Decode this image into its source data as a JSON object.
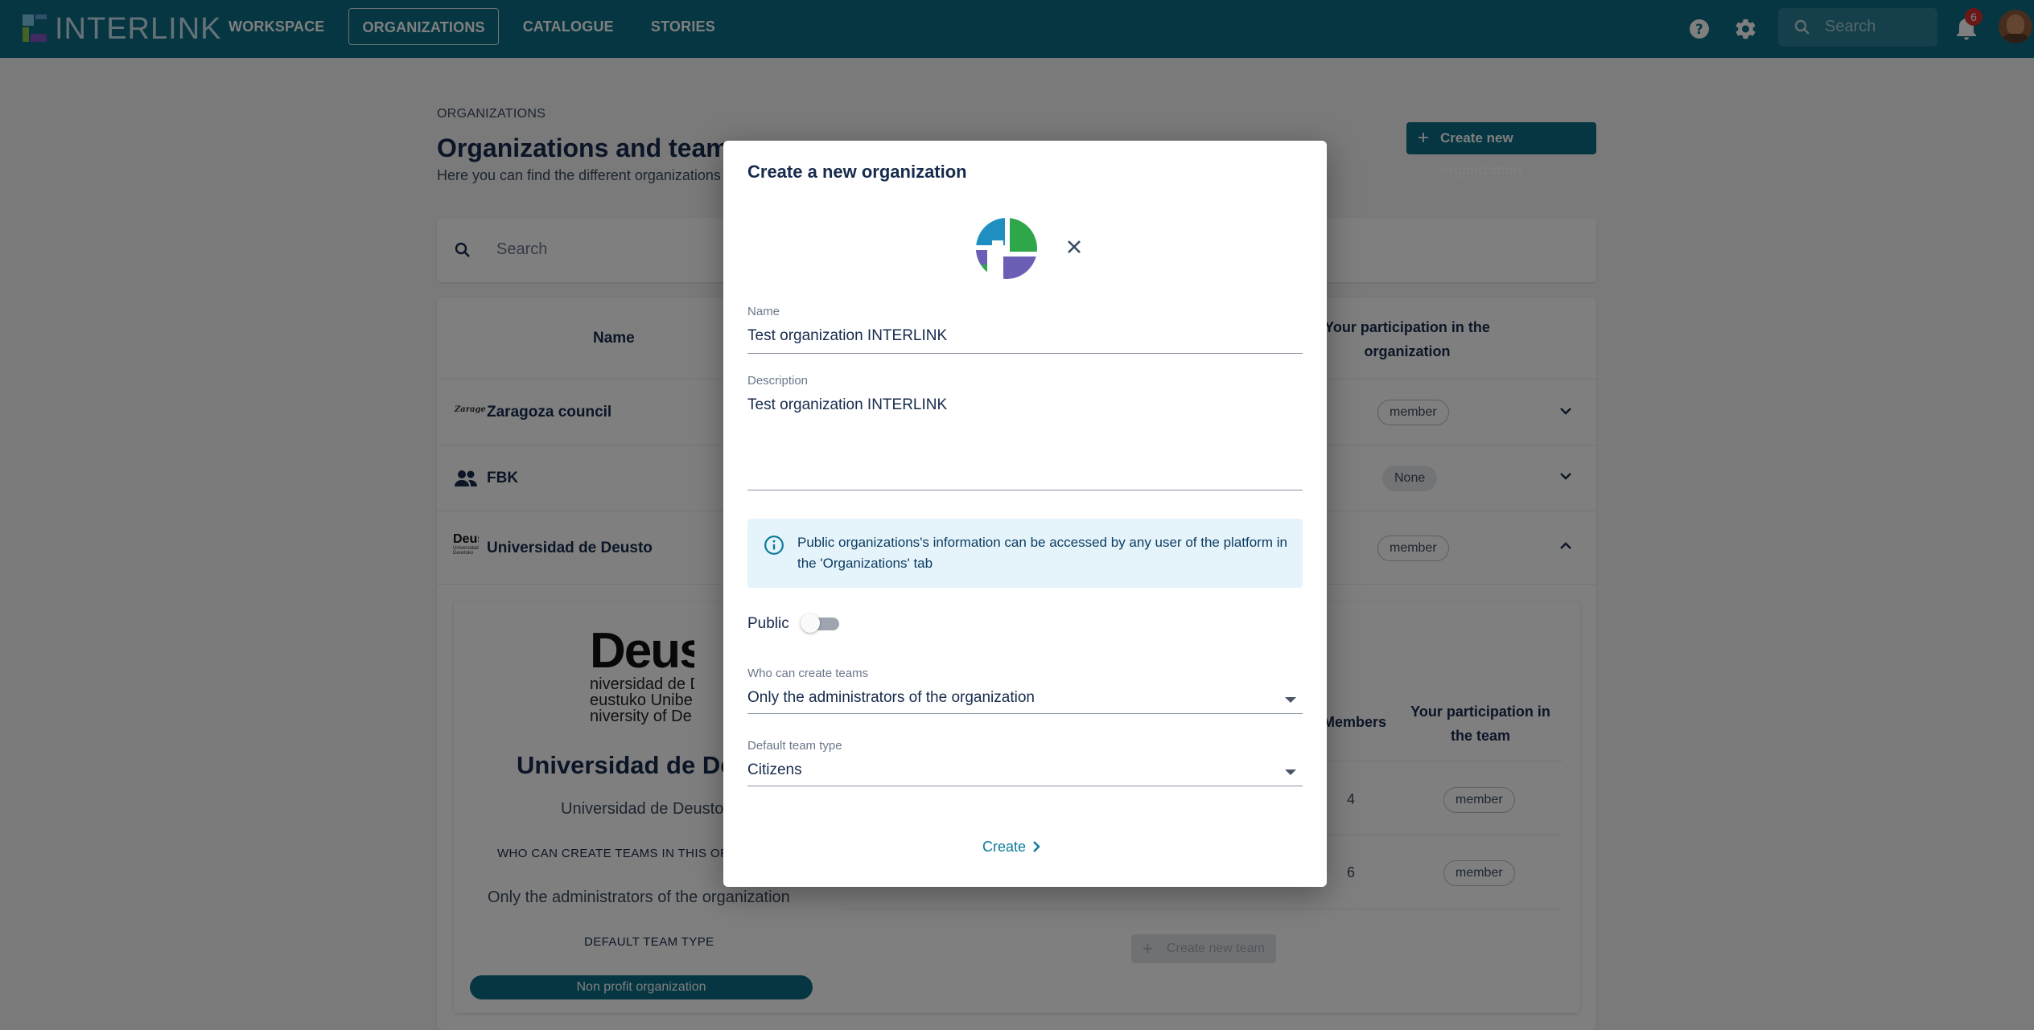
{
  "topbar": {
    "logo_text": "INTERLINK",
    "nav": [
      "WORKSPACE",
      "ORGANIZATIONS",
      "CATALOGUE",
      "STORIES"
    ],
    "search_placeholder": "Search",
    "notification_count": "6",
    "icons": [
      "help-icon",
      "gear-icon",
      "search-icon",
      "bell-icon"
    ]
  },
  "page": {
    "breadcrumb": "ORGANIZATIONS",
    "title": "Organizations and teams p",
    "subtitle": "Here you can find the different organizations",
    "create_org_label": "Create new organization",
    "search_placeholder": "Search",
    "col_name": "Name",
    "col_participation": "Your participation in the organization",
    "rows": [
      {
        "name": "Zaragoza council",
        "participation": "member"
      },
      {
        "name": "FBK",
        "participation": "None"
      },
      {
        "name": "Universidad de Deusto",
        "participation": "member"
      }
    ]
  },
  "detail": {
    "logo_big": "Deus",
    "logo_lines": [
      "niversidad de D",
      "eustuko Unibe",
      "niversity of De"
    ],
    "title": "Universidad de Deu",
    "description": "Universidad de Deusto",
    "who_label": "WHO CAN CREATE TEAMS IN THIS ORGA",
    "who_value": "Only the administrators of the organization",
    "default_team_label": "DEFAULT TEAM TYPE",
    "default_team_value": "Non profit organization",
    "team_col_members": "Members",
    "team_col_participation": "Your participation in the team",
    "teams": [
      {
        "members": "4",
        "participation": "member"
      },
      {
        "members": "6",
        "participation": "member"
      }
    ],
    "create_team_label": "Create new team"
  },
  "modal": {
    "title": "Create a new organization",
    "name_label": "Name",
    "name_value": "Test organization INTERLINK",
    "description_label": "Description",
    "description_value": "Test organization INTERLINK",
    "info_text": "Public organizations's information can be accessed by any user of the platform in the 'Organizations' tab",
    "public_label": "Public",
    "public_on": false,
    "who_label": "Who can create teams",
    "who_value": "Only the administrators of the organization",
    "team_type_label": "Default team type",
    "team_type_value": "Citizens",
    "create_label": "Create"
  },
  "colors": {
    "brand": "#0b6d85",
    "link": "#0b7a9a",
    "info_bg": "#e5f4fb",
    "badge": "#d32f2f"
  }
}
